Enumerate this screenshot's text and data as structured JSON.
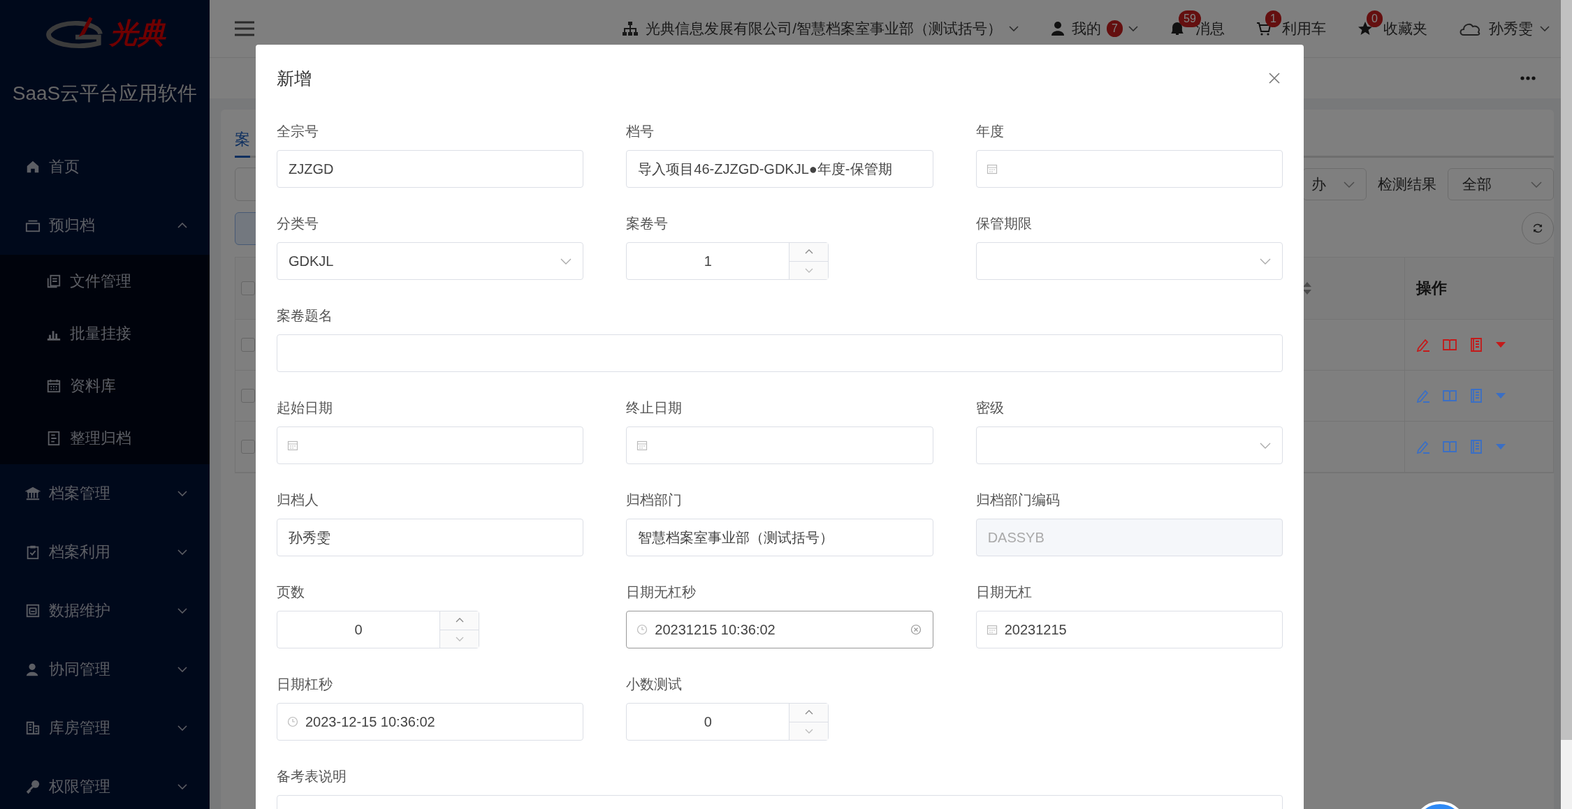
{
  "sidebar": {
    "logo_text": "光典",
    "app_name": "SaaS云平台应用软件",
    "items": [
      {
        "label": "首页"
      },
      {
        "label": "预归档",
        "expanded": true,
        "children": [
          {
            "label": "文件管理"
          },
          {
            "label": "批量挂接"
          },
          {
            "label": "资料库"
          },
          {
            "label": "整理归档"
          }
        ]
      },
      {
        "label": "档案管理",
        "expanded": false
      },
      {
        "label": "档案利用",
        "expanded": false
      },
      {
        "label": "数据维护",
        "expanded": false
      },
      {
        "label": "协同管理",
        "expanded": false
      },
      {
        "label": "库房管理",
        "expanded": false
      },
      {
        "label": "权限管理",
        "expanded": false
      }
    ]
  },
  "topbar": {
    "organization": "光典信息发展有限公司/智慧档案室事业部（测试括号）",
    "items": [
      {
        "label": "我的",
        "badge": "7"
      },
      {
        "label": "消息",
        "badge": "59"
      },
      {
        "label": "利用车",
        "badge": "1"
      },
      {
        "label": "收藏夹",
        "badge": "0"
      }
    ],
    "user": "孙秀雯"
  },
  "tabs": [
    {
      "label": "案",
      "selected": true
    }
  ],
  "filters": {
    "status_value": "办",
    "result_label": "检测结果",
    "result_value": "全部"
  },
  "table": {
    "columns": [
      "操作"
    ],
    "all_checked": false,
    "rows": [
      {
        "checked": false,
        "color": "#c41a1a"
      },
      {
        "checked": false,
        "color": "#3b6fc4"
      },
      {
        "checked": false,
        "color": "#3b6fc4"
      }
    ]
  },
  "modal": {
    "title": "新增",
    "fields": [
      {
        "label": "全宗号",
        "kind": "text",
        "value": "ZJZGD",
        "disabled": false,
        "focused": false
      },
      {
        "label": "档号",
        "kind": "text",
        "value": "导入项目46-ZJZGD-GDKJL●年度-保管期",
        "disabled": false,
        "focused": false
      },
      {
        "label": "年度",
        "kind": "date",
        "focused": false
      },
      {
        "label": "分类号",
        "kind": "select",
        "value": "GDKJL",
        "disabled": false,
        "focused": false
      },
      {
        "label": "案卷号",
        "kind": "number",
        "value": "1",
        "disabled": false,
        "focused": false
      },
      {
        "label": "保管期限",
        "kind": "select",
        "focused": false
      },
      {
        "label": "案卷题名",
        "kind": "long",
        "focused": false
      },
      {
        "label": "起始日期",
        "kind": "date",
        "focused": false
      },
      {
        "label": "终止日期",
        "kind": "date",
        "focused": false
      },
      {
        "label": "密级",
        "kind": "select",
        "focused": false
      },
      {
        "label": "归档人",
        "kind": "text",
        "value": "孙秀雯",
        "disabled": false,
        "focused": false
      },
      {
        "label": "归档部门",
        "kind": "text",
        "value": "智慧档案室事业部（测试括号）",
        "disabled": false,
        "focused": false
      },
      {
        "label": "归档部门编码",
        "kind": "text",
        "value": "DASSYB",
        "disabled": true,
        "focused": false
      },
      {
        "label": "页数",
        "kind": "number",
        "value": "0",
        "disabled": false,
        "focused": false
      },
      {
        "label": "日期无杠秒",
        "kind": "time",
        "value": "20231215 10:36:02",
        "disabled": false,
        "focused": true
      },
      {
        "label": "日期无杠",
        "kind": "date",
        "value": "20231215",
        "disabled": false,
        "focused": false
      },
      {
        "label": "日期杠秒",
        "kind": "time",
        "value": "2023-12-15 10:36:02",
        "disabled": false,
        "focused": false
      },
      {
        "label": "小数测试",
        "kind": "number",
        "value": "0",
        "disabled": false,
        "focused": false
      },
      {
        "label": "备考表说明",
        "kind": "long",
        "focused": false
      }
    ]
  }
}
